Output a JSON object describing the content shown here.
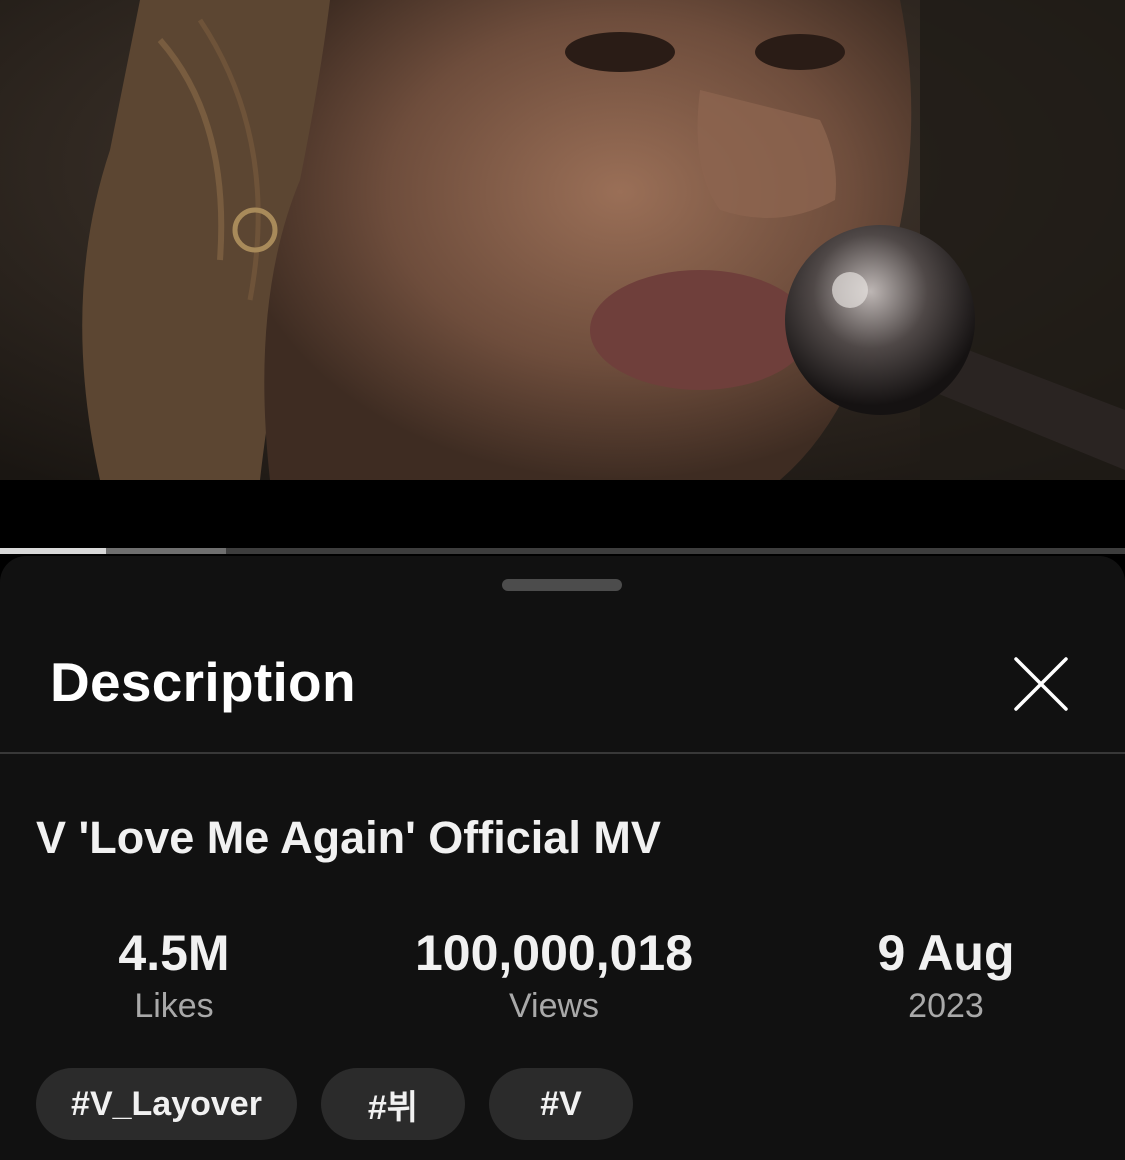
{
  "player": {
    "progress_fraction": 0.094,
    "buffer_fraction": 0.201
  },
  "sheet": {
    "title": "Description",
    "close_icon": "close-icon"
  },
  "video": {
    "title": "V 'Love Me Again' Official MV"
  },
  "stats": [
    {
      "value": "4.5M",
      "label": "Likes"
    },
    {
      "value": "100,000,018",
      "label": "Views"
    },
    {
      "value": "9 Aug",
      "label": "2023"
    }
  ],
  "hashtags": [
    "#V_Layover",
    "#뷔",
    "#V"
  ],
  "colors": {
    "sheet_bg": "#111111",
    "chip_bg": "#2b2b2b",
    "secondary_text": "#a9a9a9"
  }
}
